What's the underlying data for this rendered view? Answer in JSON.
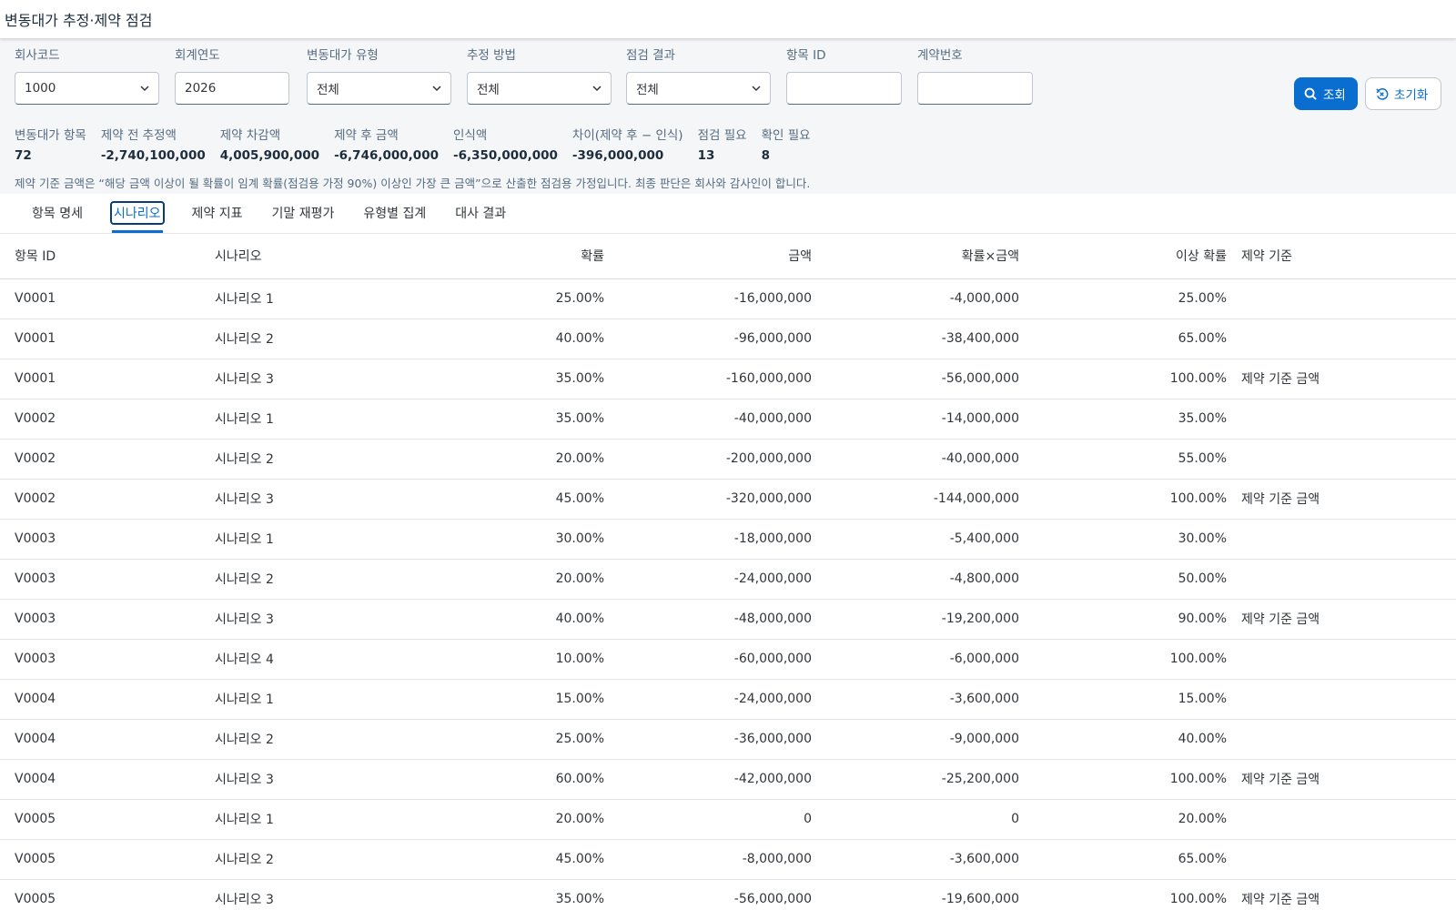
{
  "app": {
    "title": "변동대가 추정·제약 점검"
  },
  "filters": {
    "company": {
      "label": "회사코드",
      "value": "1000"
    },
    "year": {
      "label": "회계연도",
      "value": "2026"
    },
    "vc_type": {
      "label": "변동대가 유형",
      "value": "전체"
    },
    "method": {
      "label": "추정 방법",
      "value": "전체"
    },
    "result": {
      "label": "점검 결과",
      "value": "전체"
    },
    "item_id": {
      "label": "항목 ID",
      "value": ""
    },
    "contract": {
      "label": "계약번호",
      "value": ""
    },
    "search_label": "조회",
    "reset_label": "초기화"
  },
  "kpis": [
    {
      "label": "변동대가 항목",
      "value": "72"
    },
    {
      "label": "제약 전 추정액",
      "value": "-2,740,100,000"
    },
    {
      "label": "제약 차감액",
      "value": "4,005,900,000"
    },
    {
      "label": "제약 후 금액",
      "value": "-6,746,000,000"
    },
    {
      "label": "인식액",
      "value": "-6,350,000,000"
    },
    {
      "label": "차이(제약 후 − 인식)",
      "value": "-396,000,000"
    },
    {
      "label": "점검 필요",
      "value": "13"
    },
    {
      "label": "확인 필요",
      "value": "8"
    }
  ],
  "note": "제약 기준 금액은 “해당 금액 이상이 될 확률이 임계 확률(점검용 가정 90%) 이상인 가장 큰 금액”으로 산출한 점검용 가정입니다. 최종 판단은 회사와 감사인이 합니다.",
  "tabs": [
    {
      "label": "항목 명세",
      "active": false
    },
    {
      "label": "시나리오",
      "active": true
    },
    {
      "label": "제약 지표",
      "active": false
    },
    {
      "label": "기말 재평가",
      "active": false
    },
    {
      "label": "유형별 집계",
      "active": false
    },
    {
      "label": "대사 결과",
      "active": false
    }
  ],
  "table": {
    "headers": [
      "항목 ID",
      "시나리오",
      "확률",
      "금액",
      "확률×금액",
      "이상 확률",
      "제약 기준"
    ],
    "rows": [
      [
        "V0001",
        "시나리오 1",
        "25.00%",
        "-16,000,000",
        "-4,000,000",
        "25.00%",
        ""
      ],
      [
        "V0001",
        "시나리오 2",
        "40.00%",
        "-96,000,000",
        "-38,400,000",
        "65.00%",
        ""
      ],
      [
        "V0001",
        "시나리오 3",
        "35.00%",
        "-160,000,000",
        "-56,000,000",
        "100.00%",
        "제약 기준 금액"
      ],
      [
        "V0002",
        "시나리오 1",
        "35.00%",
        "-40,000,000",
        "-14,000,000",
        "35.00%",
        ""
      ],
      [
        "V0002",
        "시나리오 2",
        "20.00%",
        "-200,000,000",
        "-40,000,000",
        "55.00%",
        ""
      ],
      [
        "V0002",
        "시나리오 3",
        "45.00%",
        "-320,000,000",
        "-144,000,000",
        "100.00%",
        "제약 기준 금액"
      ],
      [
        "V0003",
        "시나리오 1",
        "30.00%",
        "-18,000,000",
        "-5,400,000",
        "30.00%",
        ""
      ],
      [
        "V0003",
        "시나리오 2",
        "20.00%",
        "-24,000,000",
        "-4,800,000",
        "50.00%",
        ""
      ],
      [
        "V0003",
        "시나리오 3",
        "40.00%",
        "-48,000,000",
        "-19,200,000",
        "90.00%",
        "제약 기준 금액"
      ],
      [
        "V0003",
        "시나리오 4",
        "10.00%",
        "-60,000,000",
        "-6,000,000",
        "100.00%",
        ""
      ],
      [
        "V0004",
        "시나리오 1",
        "15.00%",
        "-24,000,000",
        "-3,600,000",
        "15.00%",
        ""
      ],
      [
        "V0004",
        "시나리오 2",
        "25.00%",
        "-36,000,000",
        "-9,000,000",
        "40.00%",
        ""
      ],
      [
        "V0004",
        "시나리오 3",
        "60.00%",
        "-42,000,000",
        "-25,200,000",
        "100.00%",
        "제약 기준 금액"
      ],
      [
        "V0005",
        "시나리오 1",
        "20.00%",
        "0",
        "0",
        "20.00%",
        ""
      ],
      [
        "V0005",
        "시나리오 2",
        "45.00%",
        "-8,000,000",
        "-3,600,000",
        "65.00%",
        ""
      ],
      [
        "V0005",
        "시나리오 3",
        "35.00%",
        "-56,000,000",
        "-19,600,000",
        "100.00%",
        "제약 기준 금액"
      ]
    ]
  }
}
